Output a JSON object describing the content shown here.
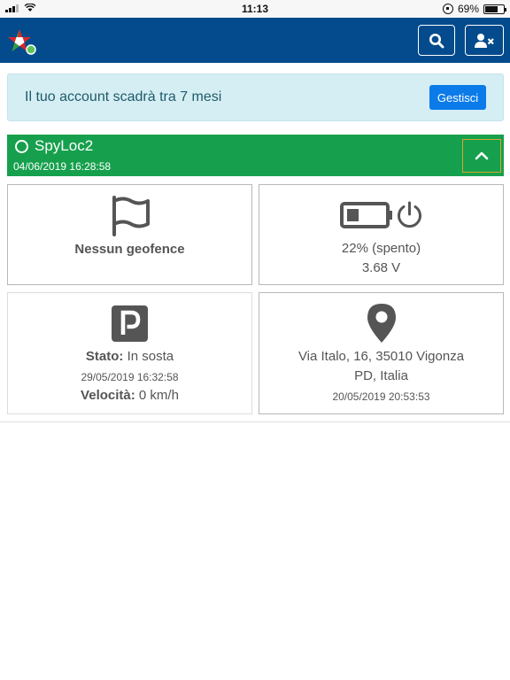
{
  "status_bar": {
    "time": "11:13",
    "battery_percent": "69%",
    "battery_level": 0.69
  },
  "header": {
    "logo_icon": "star-logo-icon",
    "search_icon": "search-icon",
    "user_icon": "user-times-icon",
    "background": "#034b8c"
  },
  "notice": {
    "message": "Il tuo account scadrà tra 7 mesi",
    "button": "Gestisci"
  },
  "device": {
    "name": "SpyLoc2",
    "timestamp": "04/06/2019 16:28:58",
    "color": "#16a04d"
  },
  "cards": {
    "geofence": {
      "icon": "flag-icon",
      "text": "Nessun geofence"
    },
    "battery": {
      "icon": "battery-icon",
      "power_icon": "power-icon",
      "level_text": "22% (spento)",
      "voltage": "3.68 V",
      "level": 0.22
    },
    "parking": {
      "icon": "parking-icon",
      "status_label": "Stato:",
      "status_value": "In sosta",
      "timestamp": "29/05/2019 16:32:58",
      "speed_label": "Velocità:",
      "speed_value": "0 km/h"
    },
    "location": {
      "icon": "map-marker-icon",
      "address_line1": "Via Italo, 16, 35010 Vigonza",
      "address_line2": "PD, Italia",
      "timestamp": "20/05/2019 20:53:53"
    }
  }
}
